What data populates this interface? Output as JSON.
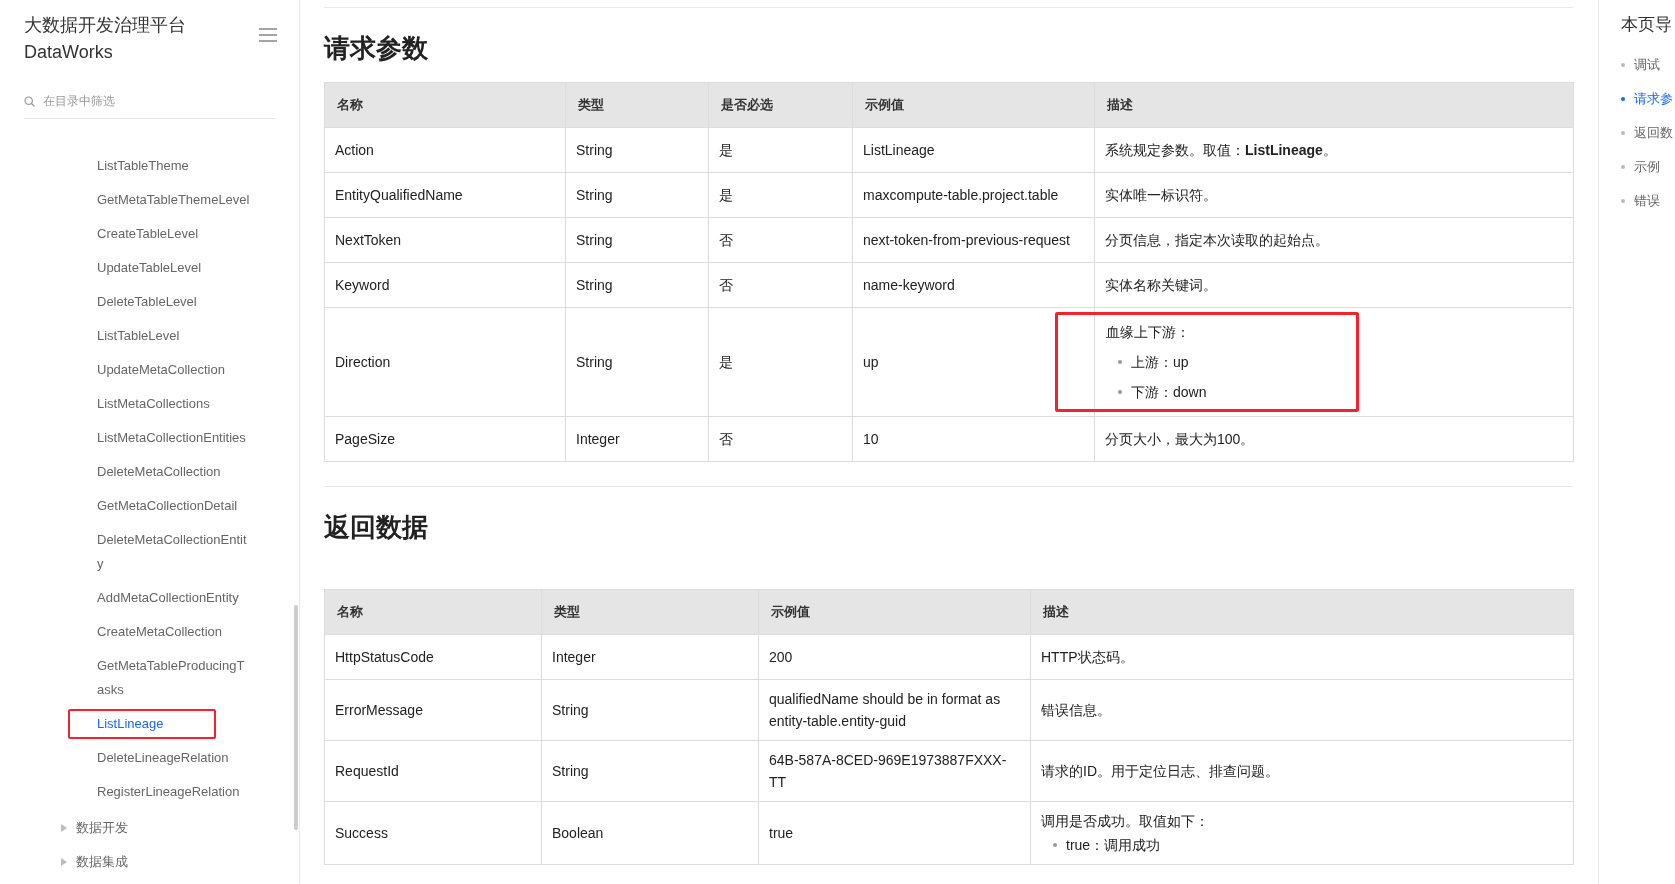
{
  "sidebar": {
    "title": "大数据开发治理平台",
    "subtitle": "DataWorks",
    "search": {
      "placeholder": "在目录中筛选"
    },
    "items": [
      {
        "label": "ListTableTheme",
        "selected": false,
        "highlighted": false
      },
      {
        "label": "GetMetaTableThemeLevel",
        "selected": false,
        "highlighted": false
      },
      {
        "label": "CreateTableLevel",
        "selected": false,
        "highlighted": false
      },
      {
        "label": "UpdateTableLevel",
        "selected": false,
        "highlighted": false
      },
      {
        "label": "DeleteTableLevel",
        "selected": false,
        "highlighted": false
      },
      {
        "label": "ListTableLevel",
        "selected": false,
        "highlighted": false
      },
      {
        "label": "UpdateMetaCollection",
        "selected": false,
        "highlighted": false
      },
      {
        "label": "ListMetaCollections",
        "selected": false,
        "highlighted": false
      },
      {
        "label": "ListMetaCollectionEntities",
        "selected": false,
        "highlighted": false
      },
      {
        "label": "DeleteMetaCollection",
        "selected": false,
        "highlighted": false
      },
      {
        "label": "GetMetaCollectionDetail",
        "selected": false,
        "highlighted": false
      },
      {
        "label": "DeleteMetaCollectionEntity",
        "selected": false,
        "highlighted": false
      },
      {
        "label": "AddMetaCollectionEntity",
        "selected": false,
        "highlighted": false
      },
      {
        "label": "CreateMetaCollection",
        "selected": false,
        "highlighted": false
      },
      {
        "label": "GetMetaTableProducingTasks",
        "selected": false,
        "highlighted": false
      },
      {
        "label": "ListLineage",
        "selected": true,
        "highlighted": true
      },
      {
        "label": "DeleteLineageRelation",
        "selected": false,
        "highlighted": false
      },
      {
        "label": "RegisterLineageRelation",
        "selected": false,
        "highlighted": false
      }
    ],
    "groups": [
      {
        "label": "数据开发",
        "expanded": false
      },
      {
        "label": "数据集成",
        "expanded": false
      }
    ]
  },
  "sections": [
    {
      "heading": "请求参数",
      "table": {
        "columns": [
          "名称",
          "类型",
          "是否必选",
          "示例值",
          "描述"
        ],
        "rows": [
          {
            "cells": [
              "Action",
              "String",
              "是",
              "ListLineage"
            ],
            "description": {
              "text": "系统规定参数。取值：**ListLineage**。",
              "highlighted": false
            }
          },
          {
            "cells": [
              "EntityQualifiedName",
              "String",
              "是",
              "maxcompute-table.project.table"
            ],
            "description": {
              "text": "实体唯一标识符。",
              "highlighted": false
            }
          },
          {
            "cells": [
              "NextToken",
              "String",
              "否",
              "next-token-from-previous-request"
            ],
            "description": {
              "text": "分页信息，指定本次读取的起始点。",
              "highlighted": false
            }
          },
          {
            "cells": [
              "Keyword",
              "String",
              "否",
              "name-keyword"
            ],
            "description": {
              "text": "实体名称关键词。",
              "highlighted": false
            }
          },
          {
            "cells": [
              "Direction",
              "String",
              "是",
              "up"
            ],
            "description": {
              "text": "血缘上下游：",
              "bullets": [
                "上游：up",
                "下游：down"
              ],
              "highlighted": true
            }
          },
          {
            "cells": [
              "PageSize",
              "Integer",
              "否",
              "10"
            ],
            "description": {
              "text": "分页大小，最大为100。",
              "highlighted": false
            }
          }
        ]
      }
    },
    {
      "heading": "返回数据",
      "table": {
        "columns": [
          "名称",
          "类型",
          "示例值",
          "描述"
        ],
        "rows": [
          {
            "cells": [
              "HttpStatusCode",
              "Integer",
              "200"
            ],
            "description": {
              "text": "HTTP状态码。",
              "highlighted": false
            }
          },
          {
            "cells": [
              "ErrorMessage",
              "String",
              "qualifiedName should be in format as entity-table.entity-guid"
            ],
            "description": {
              "text": "错误信息。",
              "highlighted": false
            }
          },
          {
            "cells": [
              "RequestId",
              "String",
              "64B-587A-8CED-969E1973887FXXX-TT"
            ],
            "description": {
              "text": "请求的ID。用于定位日志、排查问题。",
              "highlighted": false
            }
          },
          {
            "cells": [
              "Success",
              "Boolean",
              "true"
            ],
            "description": {
              "text": "调用是否成功。取值如下：",
              "bullets": [
                "true：调用成功"
              ],
              "highlighted": false
            }
          }
        ]
      }
    }
  ],
  "toc": {
    "title": "本页导",
    "items": [
      {
        "label": "调试",
        "selected": false
      },
      {
        "label": "请求参",
        "selected": true
      },
      {
        "label": "返回数",
        "selected": false
      },
      {
        "label": "示例",
        "selected": false
      },
      {
        "label": "错误",
        "selected": false
      }
    ]
  }
}
